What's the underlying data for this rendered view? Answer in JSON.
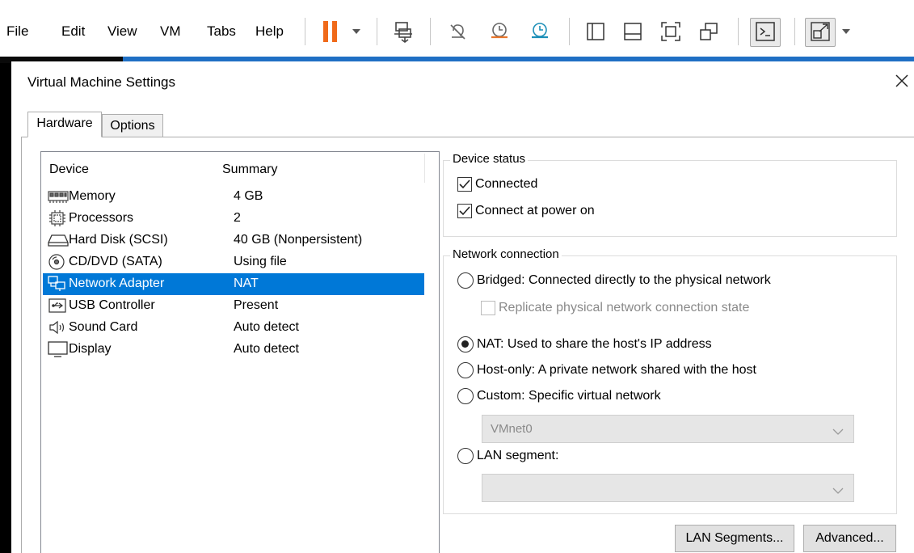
{
  "menubar": {
    "items": [
      "File",
      "Edit",
      "View",
      "VM",
      "Tabs",
      "Help"
    ]
  },
  "toolbar": {
    "icons": [
      "pause-icon",
      "dropdown-arrow-icon",
      "send-ctrl-alt-del-icon",
      "snapshot-disabled-icon",
      "revert-snapshot-icon",
      "snapshot-manager-icon",
      "library-view-icon",
      "thumbnail-bar-icon",
      "full-screen-icon",
      "unity-icon",
      "console-view-icon",
      "stretch-guest-icon"
    ],
    "accent_pause": "#f06a1a"
  },
  "dialog": {
    "title": "Virtual Machine Settings",
    "close_glyph": "✕",
    "tabs": [
      {
        "label": "Hardware",
        "active": true
      },
      {
        "label": "Options",
        "active": false
      }
    ]
  },
  "devices": {
    "headers": {
      "device": "Device",
      "summary": "Summary"
    },
    "rows": [
      {
        "name": "Memory",
        "summary": "4 GB",
        "icon": "memory-icon"
      },
      {
        "name": "Processors",
        "summary": "2",
        "icon": "processor-icon"
      },
      {
        "name": "Hard Disk (SCSI)",
        "summary": "40 GB (Nonpersistent)",
        "icon": "hard-disk-icon"
      },
      {
        "name": "CD/DVD (SATA)",
        "summary": "Using file",
        "icon": "cd-dvd-icon"
      },
      {
        "name": "Network Adapter",
        "summary": "NAT",
        "icon": "network-adapter-icon",
        "selected": true
      },
      {
        "name": "USB Controller",
        "summary": "Present",
        "icon": "usb-icon"
      },
      {
        "name": "Sound Card",
        "summary": "Auto detect",
        "icon": "speaker-icon"
      },
      {
        "name": "Display",
        "summary": "Auto detect",
        "icon": "display-icon"
      }
    ],
    "selection_color": "#0078d7"
  },
  "device_status": {
    "legend": "Device status",
    "connected": {
      "label": "Connected",
      "checked": true
    },
    "connect_at_power_on": {
      "label": "Connect at power on",
      "checked": true
    }
  },
  "network_connection": {
    "legend": "Network connection",
    "bridged": {
      "label": "Bridged: Connected directly to the physical network",
      "selected": false
    },
    "replicate": {
      "label": "Replicate physical network connection state",
      "checked": false,
      "enabled": false
    },
    "nat": {
      "label": "NAT: Used to share the host's IP address",
      "selected": true
    },
    "host_only": {
      "label": "Host-only: A private network shared with the host",
      "selected": false
    },
    "custom": {
      "label": "Custom: Specific virtual network",
      "selected": false
    },
    "custom_select": {
      "value": "VMnet0",
      "enabled": false
    },
    "lan_segment": {
      "label": "LAN segment:",
      "selected": false
    },
    "lan_select": {
      "value": "",
      "enabled": false
    }
  },
  "buttons": {
    "lan_segments": "LAN Segments...",
    "advanced": "Advanced..."
  }
}
